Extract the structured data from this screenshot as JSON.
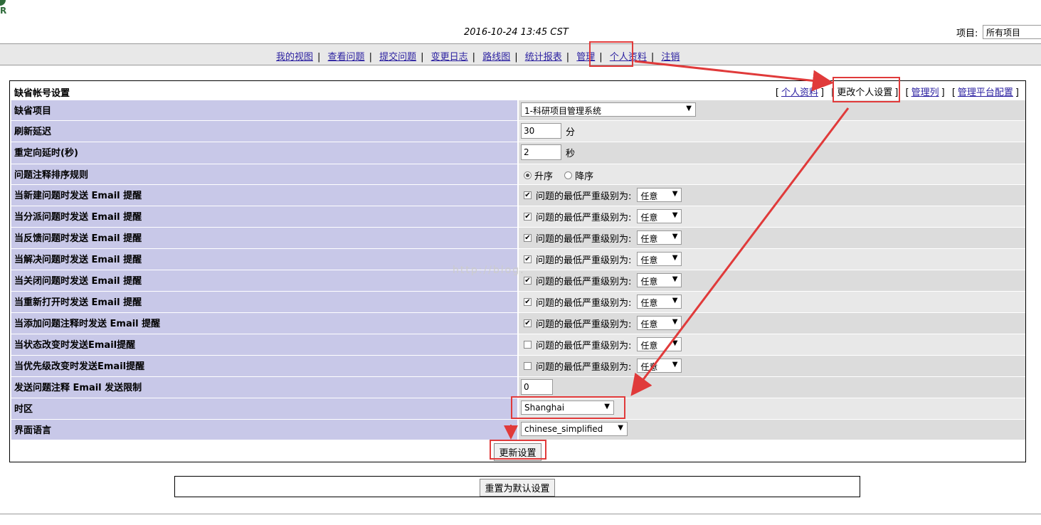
{
  "header": {
    "timestamp": "2016-10-24 13:45 CST",
    "project_label": "项目:",
    "project_selected": "所有项目"
  },
  "menu": [
    "我的视图",
    "查看问题",
    "提交问题",
    "变更日志",
    "路线图",
    "统计报表",
    "管理",
    "个人资料",
    "注销"
  ],
  "panel": {
    "title": "缺省帐号设置",
    "links": [
      "个人资料",
      "更改个人设置",
      "管理列",
      "管理平台配置"
    ]
  },
  "settings": {
    "default_project": {
      "label": "缺省项目",
      "value": "1-科研项目管理系统"
    },
    "refresh_delay": {
      "label": "刷新延迟",
      "value": "30",
      "unit": "分"
    },
    "redirect_delay": {
      "label": "重定向延时(秒)",
      "value": "2",
      "unit": "秒"
    },
    "note_order": {
      "label": "问题注释排序规则",
      "option_asc": "升序",
      "option_desc": "降序",
      "selected": "升序"
    },
    "severity_prompt": "问题的最低严重级别为:",
    "severity_value": "任意",
    "emails": [
      {
        "label": "当新建问题时发送 Email 提醒",
        "checked": true
      },
      {
        "label": "当分派问题时发送 Email 提醒",
        "checked": true
      },
      {
        "label": "当反馈问题时发送 Email 提醒",
        "checked": true
      },
      {
        "label": "当解决问题时发送 Email 提醒",
        "checked": true
      },
      {
        "label": "当关闭问题时发送 Email 提醒",
        "checked": true
      },
      {
        "label": "当重新打开时发送 Email 提醒",
        "checked": true
      },
      {
        "label": "当添加问题注释时发送 Email 提醒",
        "checked": true
      },
      {
        "label": "当状态改变时发送Email提醒",
        "checked": false
      },
      {
        "label": "当优先级改变时发送Email提醒",
        "checked": false
      }
    ],
    "email_note_limit": {
      "label": "发送问题注释 Email 发送限制",
      "value": "0"
    },
    "timezone": {
      "label": "时区",
      "value": "Shanghai"
    },
    "language": {
      "label": "界面语言",
      "value": "chinese_simplified"
    }
  },
  "buttons": {
    "update": "更新设置",
    "reset": "重置为默认设置"
  },
  "watermark": "http://blog.",
  "annotation_color": "#e03a3a"
}
